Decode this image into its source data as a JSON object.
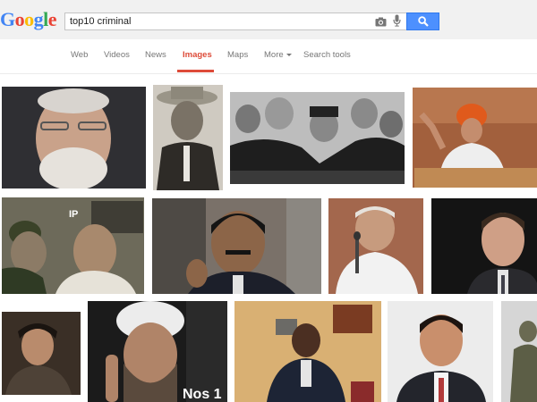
{
  "header": {
    "logo_letters": [
      {
        "char": "G",
        "color": "#4285f4"
      },
      {
        "char": "o",
        "color": "#ea4335"
      },
      {
        "char": "o",
        "color": "#fbbc05"
      },
      {
        "char": "g",
        "color": "#4285f4"
      },
      {
        "char": "l",
        "color": "#34a853"
      },
      {
        "char": "e",
        "color": "#ea4335"
      }
    ],
    "search_value": "top10 criminal",
    "icons": {
      "camera": "camera-icon",
      "mic": "microphone-icon",
      "search": "search-icon"
    },
    "accent_color": "#4d90fe"
  },
  "nav": {
    "tabs": [
      {
        "label": "Web",
        "active": false
      },
      {
        "label": "Videos",
        "active": false
      },
      {
        "label": "News",
        "active": false
      },
      {
        "label": "Images",
        "active": true
      },
      {
        "label": "Maps",
        "active": false
      },
      {
        "label": "More",
        "active": false
      },
      {
        "label": "Search tools",
        "active": false
      }
    ],
    "active_color": "#dd4b39"
  },
  "results": {
    "image_text": {
      "jail_sign": "IP",
      "caption": "Nos 1"
    }
  }
}
